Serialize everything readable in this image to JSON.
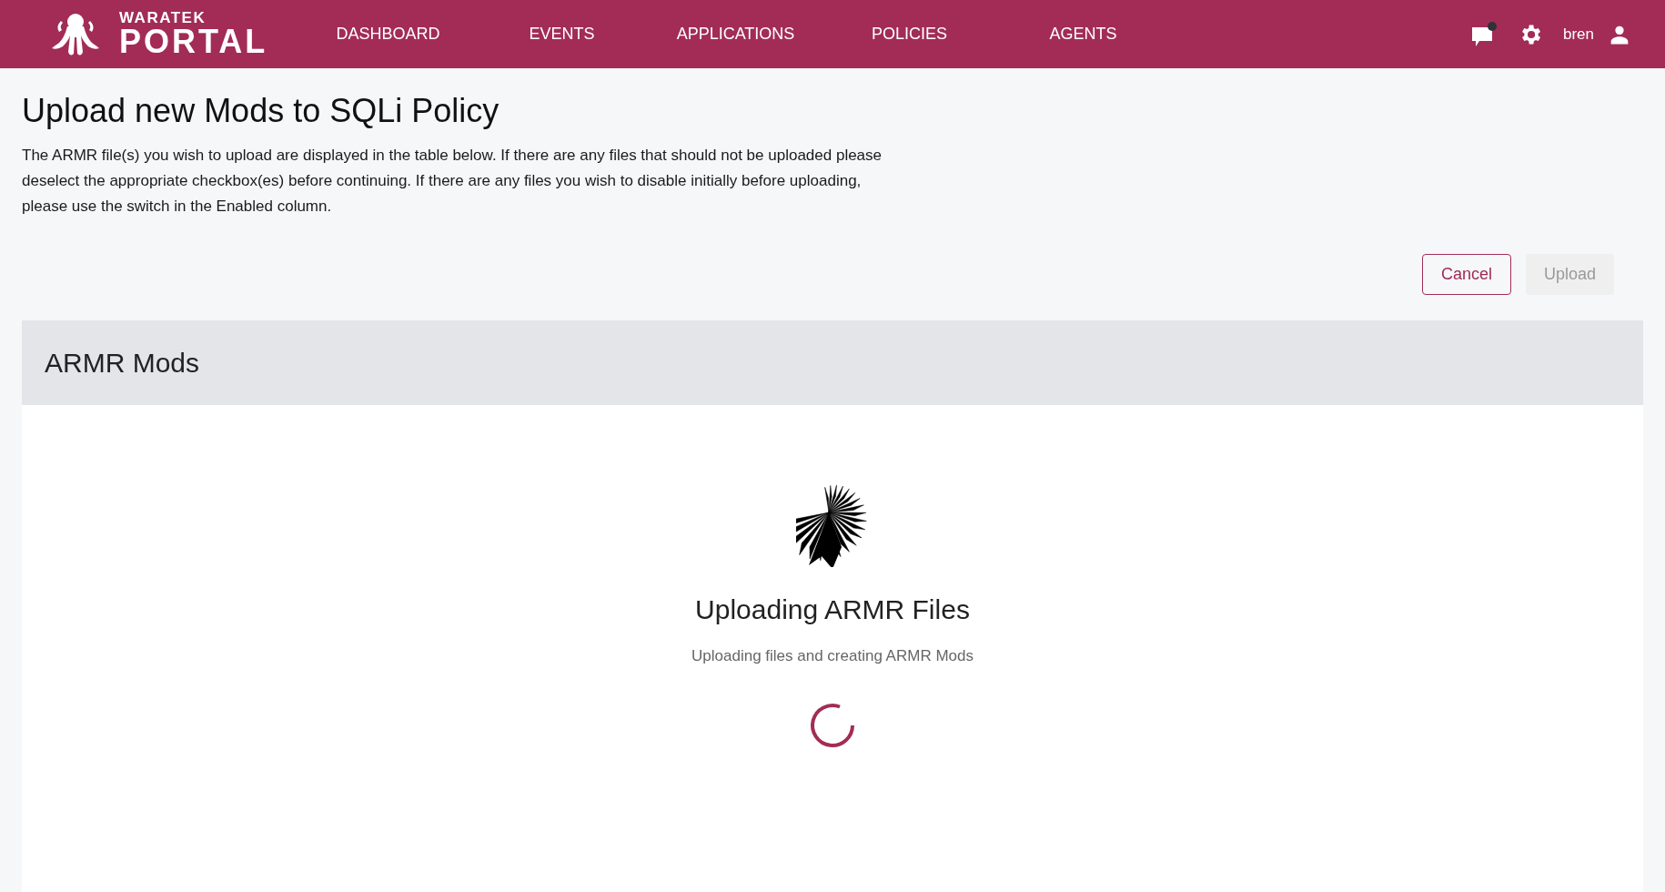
{
  "header": {
    "brand_top": "WARATEK",
    "brand_main": "PORTAL",
    "nav": [
      {
        "label": "DASHBOARD",
        "selected": false
      },
      {
        "label": "EVENTS",
        "selected": false
      },
      {
        "label": "APPLICATIONS",
        "selected": false
      },
      {
        "label": "POLICIES",
        "selected": false
      },
      {
        "label": "AGENTS",
        "selected": false
      }
    ],
    "notifications": {
      "unread": true
    },
    "user": "bren"
  },
  "page": {
    "title": "Upload new Mods to SQLi Policy",
    "description": "The ARMR file(s) you wish to upload are displayed in the table below. If there are any files that should not be uploaded please deselect the appropriate checkbox(es) before continuing. If there are any files you wish to disable initially before uploading, please use the switch in the Enabled column.",
    "buttons": [
      {
        "label": "Cancel",
        "disabled": false
      },
      {
        "label": "Upload",
        "disabled": true
      }
    ]
  },
  "panel": {
    "title": "ARMR Mods",
    "status_title": "Uploading ARMR Files",
    "status_text": "Uploading files and creating ARMR Mods"
  }
}
